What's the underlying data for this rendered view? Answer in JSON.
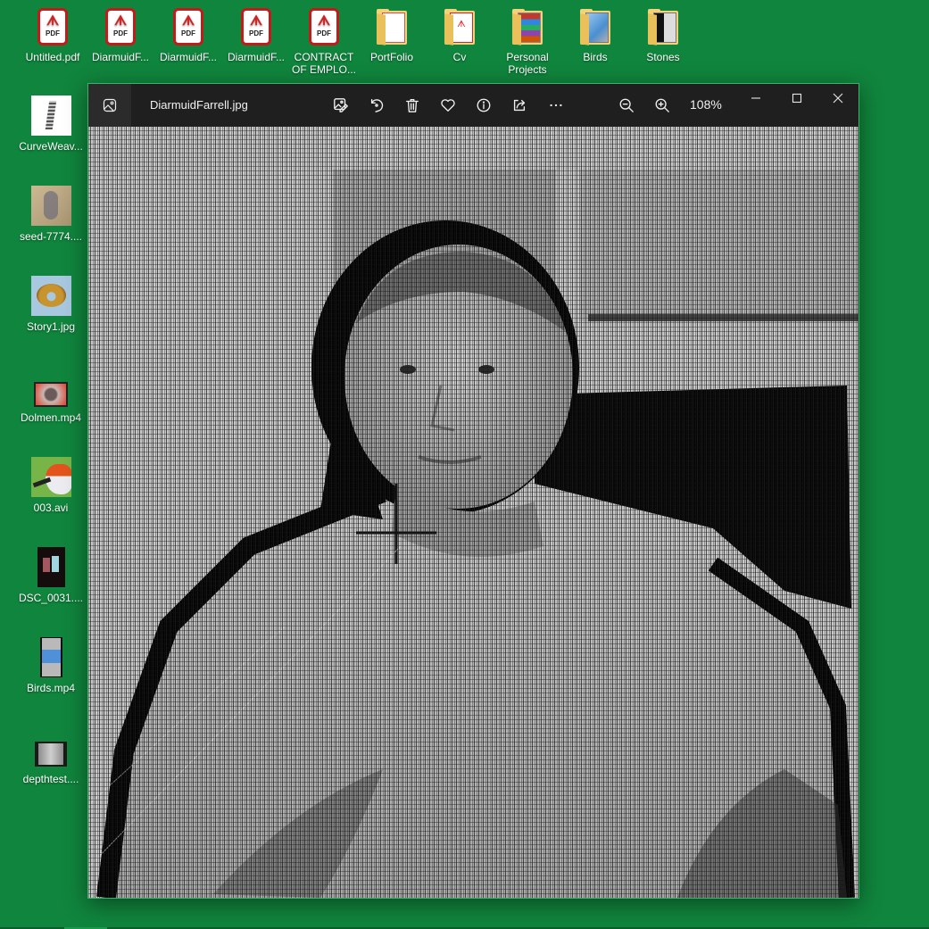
{
  "desktop": {
    "background_color": "#10853d",
    "top_row": [
      {
        "label": "Untitled.pdf",
        "type": "pdf"
      },
      {
        "label": "DiarmuidF...",
        "type": "pdf"
      },
      {
        "label": "DiarmuidF...",
        "type": "pdf"
      },
      {
        "label": "DiarmuidF...",
        "type": "pdf"
      },
      {
        "label": "CONTRACT OF EMPLO...",
        "type": "pdf"
      },
      {
        "label": "PortFolio",
        "type": "folder"
      },
      {
        "label": "Cv",
        "type": "folder"
      },
      {
        "label": "Personal Projects",
        "type": "folder"
      },
      {
        "label": "Birds",
        "type": "folder"
      },
      {
        "label": "Stones",
        "type": "folder"
      }
    ],
    "left_column": [
      {
        "label": "CurveWeav...",
        "type": "image"
      },
      {
        "label": "seed-7774....",
        "type": "image"
      },
      {
        "label": "Story1.jpg",
        "type": "image"
      },
      {
        "label": "Dolmen.mp4",
        "type": "video"
      },
      {
        "label": "003.avi",
        "type": "video"
      },
      {
        "label": "DSC_0031....",
        "type": "video"
      },
      {
        "label": "Birds.mp4",
        "type": "video"
      },
      {
        "label": "depthtest....",
        "type": "video"
      }
    ]
  },
  "viewer": {
    "title": "DiarmuidFarrell.jpg",
    "zoom_level": "108%",
    "toolbar": [
      {
        "name": "edit-image",
        "icon": "edit-image-icon",
        "tooltip": "Edit image"
      },
      {
        "name": "rotate",
        "icon": "rotate-icon",
        "tooltip": "Rotate"
      },
      {
        "name": "delete",
        "icon": "trash-icon",
        "tooltip": "Delete"
      },
      {
        "name": "favorite",
        "icon": "heart-icon",
        "tooltip": "Favorite"
      },
      {
        "name": "file-info",
        "icon": "info-icon",
        "tooltip": "File information"
      },
      {
        "name": "share",
        "icon": "share-icon",
        "tooltip": "Share"
      },
      {
        "name": "more",
        "icon": "more-icon",
        "tooltip": "See more"
      }
    ],
    "zoom_out_icon": "zoom-out-icon",
    "zoom_in_icon": "zoom-in-icon",
    "window_controls": [
      "minimize",
      "maximize",
      "close"
    ],
    "image_description": "Grayscale photo of a man, overlaid with a dense black grid/dither pattern, with a thick black outline around head and shoulders and a dark rectangle (monitor) on the right"
  }
}
